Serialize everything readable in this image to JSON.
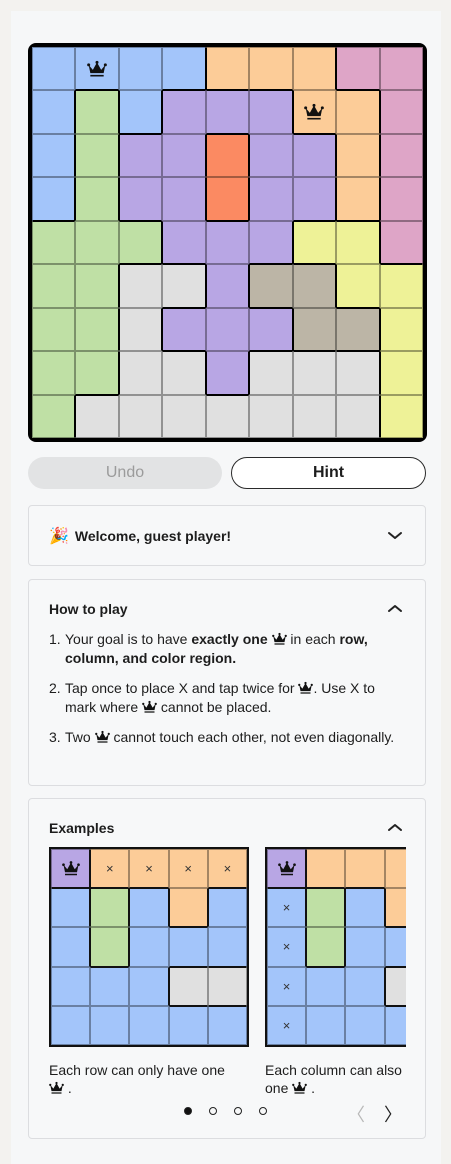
{
  "colors": {
    "blue": "#a3c5fa",
    "green": "#bfe0a5",
    "lavender": "#b8a6e4",
    "peach": "#fccc98",
    "pink": "#dea5c7",
    "orange": "#fb8a62",
    "yellow": "#eef297",
    "tan": "#bcb5a6",
    "gray": "#e0e0e0"
  },
  "board": {
    "regions": [
      "BBBBPPPKK",
      "BGBLLLPPK",
      "BGLLOLLPK",
      "BGLLOLLPK",
      "GGGLLLYYK",
      "GGSSLTTYY",
      "GGSLLLTTY",
      "GGSSLSSSY",
      "GSSSSSSSY"
    ],
    "region_colors": {
      "B": "blue",
      "G": "green",
      "L": "lavender",
      "P": "peach",
      "K": "pink",
      "O": "orange",
      "Y": "yellow",
      "T": "tan",
      "S": "gray"
    },
    "queens": [
      [
        0,
        1
      ],
      [
        1,
        6
      ]
    ]
  },
  "controls": {
    "undo_label": "Undo",
    "hint_label": "Hint"
  },
  "welcome": {
    "emoji": "🎉",
    "title": "Welcome, guest player!"
  },
  "howto": {
    "title": "How to play",
    "rules": [
      {
        "num": "1.",
        "parts": [
          {
            "t": "text",
            "v": "Your goal is to have "
          },
          {
            "t": "bold",
            "v": "exactly one"
          },
          {
            "t": "icon"
          },
          {
            "t": "text",
            "v": " in each "
          },
          {
            "t": "bold",
            "v": "row, column, and color region."
          }
        ]
      },
      {
        "num": "2.",
        "parts": [
          {
            "t": "text",
            "v": "Tap once to place X and tap twice for "
          },
          {
            "t": "icon"
          },
          {
            "t": "text",
            "v": ". Use X to mark where "
          },
          {
            "t": "icon"
          },
          {
            "t": "text",
            "v": " cannot be placed."
          }
        ]
      },
      {
        "num": "3.",
        "parts": [
          {
            "t": "text",
            "v": "Two "
          },
          {
            "t": "icon"
          },
          {
            "t": "text",
            "v": " cannot touch each other, not even diagonally."
          }
        ]
      }
    ]
  },
  "examples": {
    "title": "Examples",
    "items": [
      {
        "regions": [
          "LPPPP",
          "BGBPB",
          "BGBBB",
          "BBBSS",
          "BBBBB"
        ],
        "region_colors": {
          "L": "lavender",
          "P": "peach",
          "B": "blue",
          "G": "green",
          "S": "gray"
        },
        "marks": [
          [
            0,
            0,
            "Q"
          ],
          [
            0,
            1,
            "×"
          ],
          [
            0,
            2,
            "×"
          ],
          [
            0,
            3,
            "×"
          ],
          [
            0,
            4,
            "×"
          ]
        ],
        "caption": "Each row can only have one"
      },
      {
        "regions": [
          "LPPPP",
          "BGBPB",
          "BGBBB",
          "BBBSS",
          "BBBBB"
        ],
        "region_colors": {
          "L": "lavender",
          "P": "peach",
          "B": "blue",
          "G": "green",
          "S": "gray"
        },
        "marks": [
          [
            0,
            0,
            "Q"
          ],
          [
            1,
            0,
            "×"
          ],
          [
            2,
            0,
            "×"
          ],
          [
            3,
            0,
            "×"
          ],
          [
            4,
            0,
            "×"
          ]
        ],
        "caption": "Each column can also have one"
      }
    ],
    "pages": 4,
    "current_page": 0,
    "prev_arrow": "〈",
    "next_arrow": "〉"
  }
}
